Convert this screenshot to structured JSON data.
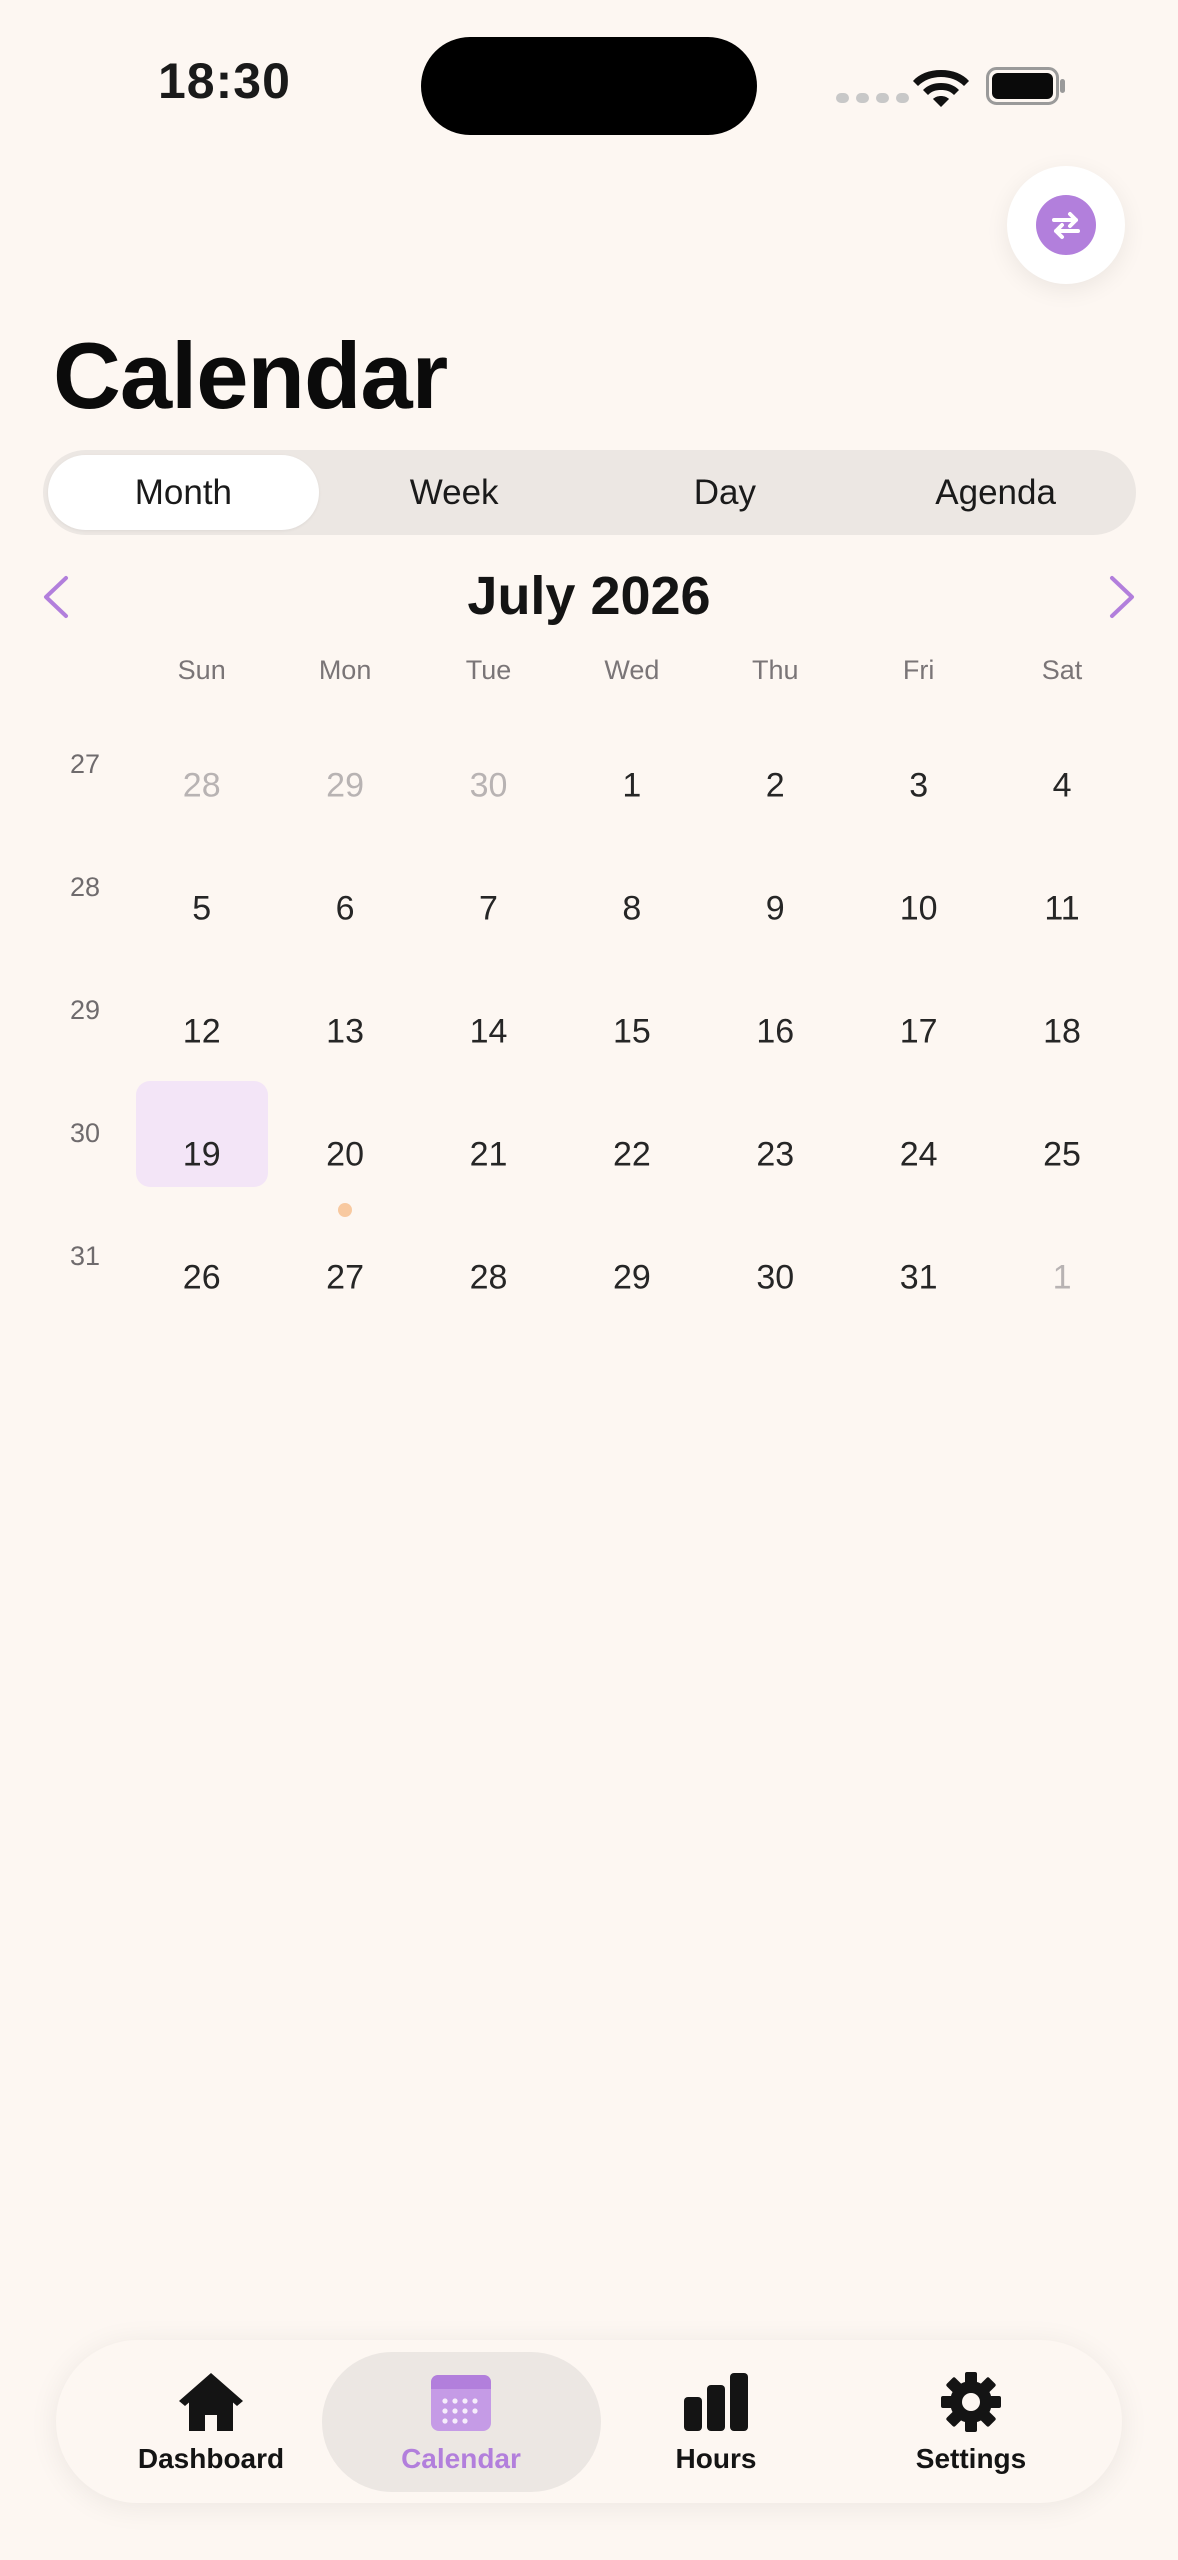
{
  "status": {
    "time": "18:30"
  },
  "header": {
    "title": "Calendar"
  },
  "view_switcher": [
    "Month",
    "Week",
    "Day",
    "Agenda"
  ],
  "month_nav": {
    "title": "July 2026"
  },
  "weekdays": [
    "Sun",
    "Mon",
    "Tue",
    "Wed",
    "Thu",
    "Fri",
    "Sat"
  ],
  "weeks": [
    {
      "num": "27",
      "days": [
        "28",
        "29",
        "30",
        "1",
        "2",
        "3",
        "4"
      ]
    },
    {
      "num": "28",
      "days": [
        "5",
        "6",
        "7",
        "8",
        "9",
        "10",
        "11"
      ]
    },
    {
      "num": "29",
      "days": [
        "12",
        "13",
        "14",
        "15",
        "16",
        "17",
        "18"
      ]
    },
    {
      "num": "30",
      "days": [
        "19",
        "20",
        "21",
        "22",
        "23",
        "24",
        "25"
      ]
    },
    {
      "num": "31",
      "days": [
        "26",
        "27",
        "28",
        "29",
        "30",
        "31",
        "1"
      ]
    }
  ],
  "tabs": [
    "Dashboard",
    "Calendar",
    "Hours",
    "Settings"
  ],
  "colors": {
    "accent": "#b27fdc",
    "today_highlight": "#f3e5f7",
    "event_dot": "#f8c9a0",
    "background": "#fdf7f2"
  }
}
